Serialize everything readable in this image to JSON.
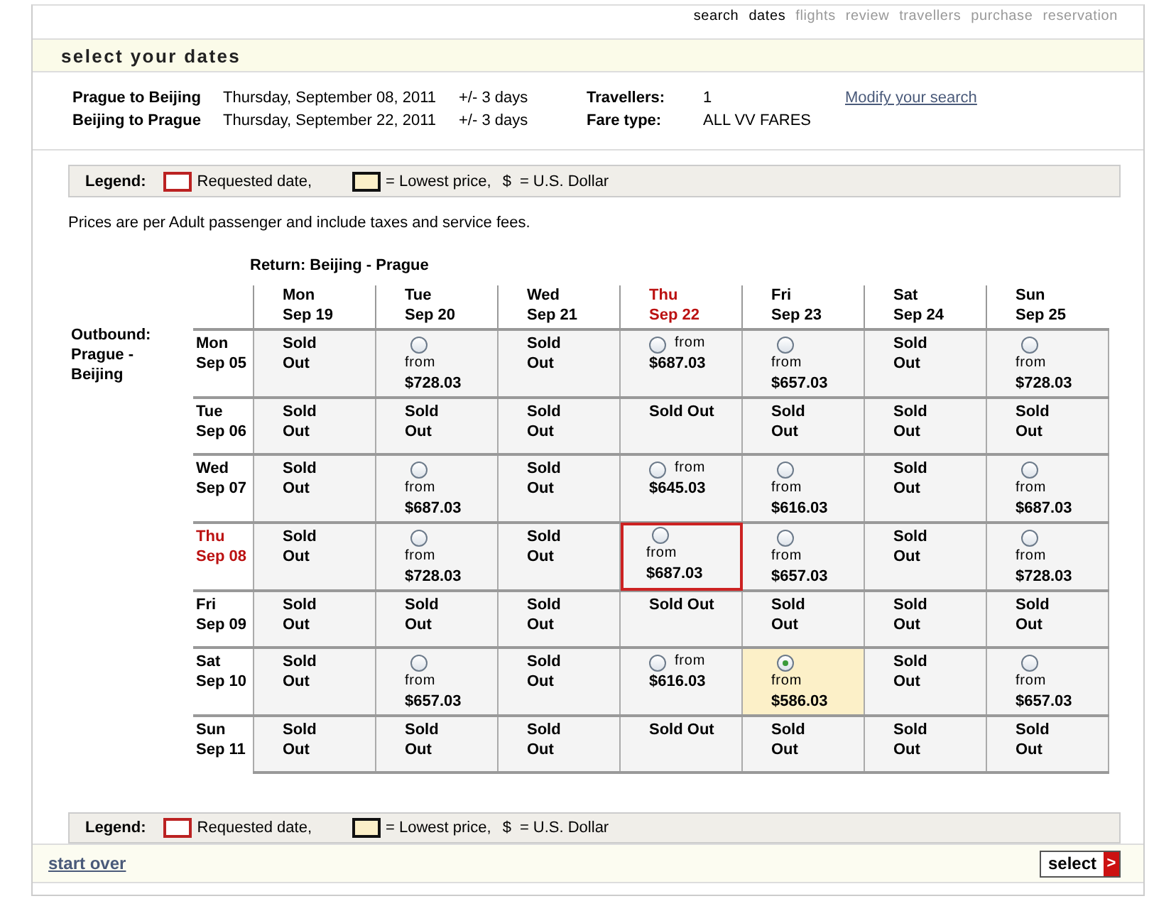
{
  "steps": [
    {
      "label": "search",
      "reached": true
    },
    {
      "label": "dates",
      "reached": true
    },
    {
      "label": "flights",
      "reached": false
    },
    {
      "label": "review",
      "reached": false
    },
    {
      "label": "travellers",
      "reached": false
    },
    {
      "label": "purchase",
      "reached": false
    },
    {
      "label": "reservation",
      "reached": false
    }
  ],
  "title": "select your dates",
  "trip": {
    "legs": [
      {
        "route": "Prague to Beijing",
        "date": "Thursday, September 08, 2011",
        "flex": "+/- 3 days",
        "label": "Travellers:",
        "value": "1"
      },
      {
        "route": "Beijing to Prague",
        "date": "Thursday, September 22, 2011",
        "flex": "+/- 3 days",
        "label": "Fare type:",
        "value": "ALL VV FARES"
      }
    ],
    "modify_link": "Modify your search"
  },
  "legend_top": {
    "title": "Legend:",
    "requested": "Requested date,",
    "lowest": "= Lowest price,",
    "currency_symbol": "$",
    "currency": "= U.S. Dollar"
  },
  "note": "Prices are per Adult passenger and include taxes and service fees.",
  "grid": {
    "return_title": "Return: Beijing - Prague",
    "outbound_title": "Outbound: Prague - Beijing",
    "columns": [
      {
        "day": "Mon",
        "date": "Sep 19",
        "requested": false
      },
      {
        "day": "Tue",
        "date": "Sep 20",
        "requested": false
      },
      {
        "day": "Wed",
        "date": "Sep 21",
        "requested": false
      },
      {
        "day": "Thu",
        "date": "Sep 22",
        "requested": true
      },
      {
        "day": "Fri",
        "date": "Sep 23",
        "requested": false
      },
      {
        "day": "Sat",
        "date": "Sep 24",
        "requested": false
      },
      {
        "day": "Sun",
        "date": "Sep 25",
        "requested": false
      }
    ],
    "rows": [
      {
        "day": "Mon",
        "date": "Sep 05",
        "requested": false,
        "cells": [
          {
            "kind": "sold_out",
            "text": "Sold Out"
          },
          {
            "kind": "fare",
            "from": "from",
            "price": "$728.03",
            "selected": false,
            "requested": false,
            "lowest": false
          },
          {
            "kind": "sold_out",
            "text": "Sold Out"
          },
          {
            "kind": "fare_inline",
            "from": "from",
            "price": "$687.03",
            "selected": false,
            "requested": false,
            "lowest": false
          },
          {
            "kind": "fare",
            "from": "from",
            "price": "$657.03",
            "selected": false,
            "requested": false,
            "lowest": false
          },
          {
            "kind": "sold_out",
            "text": "Sold Out"
          },
          {
            "kind": "fare",
            "from": "from",
            "price": "$728.03",
            "selected": false,
            "requested": false,
            "lowest": false
          }
        ]
      },
      {
        "day": "Tue",
        "date": "Sep 06",
        "requested": false,
        "cells": [
          {
            "kind": "sold_out",
            "text": "Sold Out"
          },
          {
            "kind": "sold_out",
            "text": "Sold Out"
          },
          {
            "kind": "sold_out",
            "text": "Sold Out"
          },
          {
            "kind": "sold_out_wide",
            "text": "Sold Out"
          },
          {
            "kind": "sold_out",
            "text": "Sold Out"
          },
          {
            "kind": "sold_out",
            "text": "Sold Out"
          },
          {
            "kind": "sold_out",
            "text": "Sold Out"
          }
        ]
      },
      {
        "day": "Wed",
        "date": "Sep 07",
        "requested": false,
        "cells": [
          {
            "kind": "sold_out",
            "text": "Sold Out"
          },
          {
            "kind": "fare",
            "from": "from",
            "price": "$687.03",
            "selected": false,
            "requested": false,
            "lowest": false
          },
          {
            "kind": "sold_out",
            "text": "Sold Out"
          },
          {
            "kind": "fare_inline",
            "from": "from",
            "price": "$645.03",
            "selected": false,
            "requested": false,
            "lowest": false
          },
          {
            "kind": "fare",
            "from": "from",
            "price": "$616.03",
            "selected": false,
            "requested": false,
            "lowest": false
          },
          {
            "kind": "sold_out",
            "text": "Sold Out"
          },
          {
            "kind": "fare",
            "from": "from",
            "price": "$687.03",
            "selected": false,
            "requested": false,
            "lowest": false
          }
        ]
      },
      {
        "day": "Thu",
        "date": "Sep 08",
        "requested": true,
        "cells": [
          {
            "kind": "sold_out",
            "text": "Sold Out"
          },
          {
            "kind": "fare",
            "from": "from",
            "price": "$728.03",
            "selected": false,
            "requested": false,
            "lowest": false
          },
          {
            "kind": "sold_out",
            "text": "Sold Out"
          },
          {
            "kind": "fare",
            "from": "from",
            "price": "$687.03",
            "selected": false,
            "requested": true,
            "lowest": false
          },
          {
            "kind": "fare",
            "from": "from",
            "price": "$657.03",
            "selected": false,
            "requested": false,
            "lowest": false
          },
          {
            "kind": "sold_out",
            "text": "Sold Out"
          },
          {
            "kind": "fare",
            "from": "from",
            "price": "$728.03",
            "selected": false,
            "requested": false,
            "lowest": false
          }
        ]
      },
      {
        "day": "Fri",
        "date": "Sep 09",
        "requested": false,
        "cells": [
          {
            "kind": "sold_out",
            "text": "Sold Out"
          },
          {
            "kind": "sold_out",
            "text": "Sold Out"
          },
          {
            "kind": "sold_out",
            "text": "Sold Out"
          },
          {
            "kind": "sold_out_wide",
            "text": "Sold Out"
          },
          {
            "kind": "sold_out",
            "text": "Sold Out"
          },
          {
            "kind": "sold_out",
            "text": "Sold Out"
          },
          {
            "kind": "sold_out",
            "text": "Sold Out"
          }
        ]
      },
      {
        "day": "Sat",
        "date": "Sep 10",
        "requested": false,
        "cells": [
          {
            "kind": "sold_out",
            "text": "Sold Out"
          },
          {
            "kind": "fare",
            "from": "from",
            "price": "$657.03",
            "selected": false,
            "requested": false,
            "lowest": false
          },
          {
            "kind": "sold_out",
            "text": "Sold Out"
          },
          {
            "kind": "fare_inline",
            "from": "from",
            "price": "$616.03",
            "selected": false,
            "requested": false,
            "lowest": false
          },
          {
            "kind": "fare",
            "from": "from",
            "price": "$586.03",
            "selected": true,
            "requested": false,
            "lowest": true
          },
          {
            "kind": "sold_out",
            "text": "Sold Out"
          },
          {
            "kind": "fare",
            "from": "from",
            "price": "$657.03",
            "selected": false,
            "requested": false,
            "lowest": false
          }
        ]
      },
      {
        "day": "Sun",
        "date": "Sep 11",
        "requested": false,
        "cells": [
          {
            "kind": "sold_out",
            "text": "Sold Out"
          },
          {
            "kind": "sold_out",
            "text": "Sold Out"
          },
          {
            "kind": "sold_out",
            "text": "Sold Out"
          },
          {
            "kind": "sold_out_wide",
            "text": "Sold Out"
          },
          {
            "kind": "sold_out",
            "text": "Sold Out"
          },
          {
            "kind": "sold_out",
            "text": "Sold Out"
          },
          {
            "kind": "sold_out",
            "text": "Sold Out"
          }
        ]
      }
    ]
  },
  "legend_bottom": {
    "title": "Legend:",
    "requested": "Requested date,",
    "lowest": "= Lowest price,",
    "currency_symbol": "$",
    "currency": "= U.S. Dollar"
  },
  "footer": {
    "start_over": "start over",
    "select": "select",
    "select_arrow": ">"
  }
}
